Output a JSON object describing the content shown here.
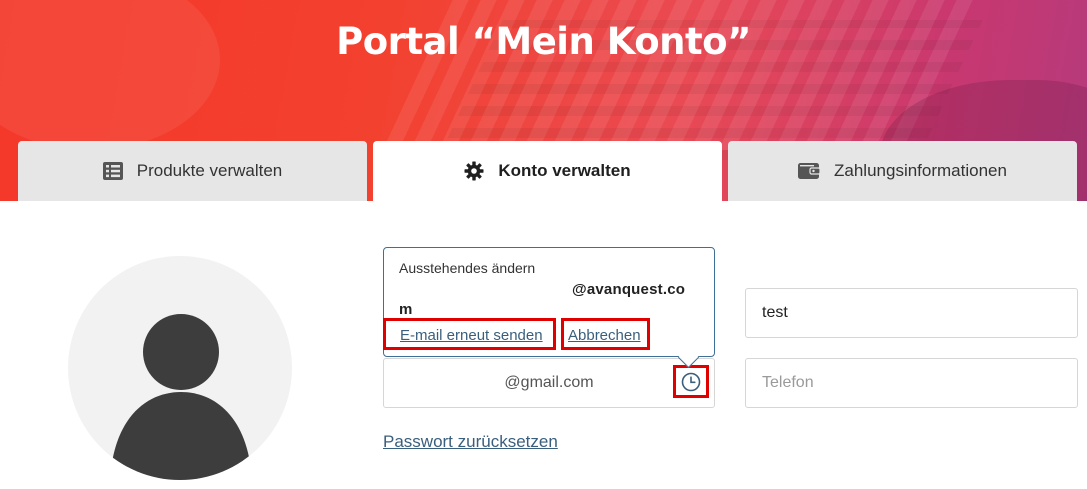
{
  "header": {
    "title": "Portal “Mein Konto”"
  },
  "tabs": [
    {
      "label": "Produkte verwalten",
      "icon": "list-icon",
      "active": false
    },
    {
      "label": "Konto verwalten",
      "icon": "gear-icon",
      "active": true
    },
    {
      "label": "Zahlungsinformationen",
      "icon": "wallet-icon",
      "active": false
    }
  ],
  "email_popover": {
    "title": "Ausstehendes ändern",
    "pending_email_line1": "@avanquest.co",
    "pending_email_line2": "m",
    "resend_label": "E-mail erneut senden",
    "cancel_label": "Abbrechen"
  },
  "form": {
    "email_value": "@gmail.com",
    "name_value": "test",
    "phone_placeholder": "Telefon",
    "reset_password_label": "Passwort zurücksetzen"
  },
  "colors": {
    "banner_start": "#f4372a",
    "banner_end": "#b53a7c",
    "link": "#3a5f7d",
    "highlight": "#e00000"
  }
}
